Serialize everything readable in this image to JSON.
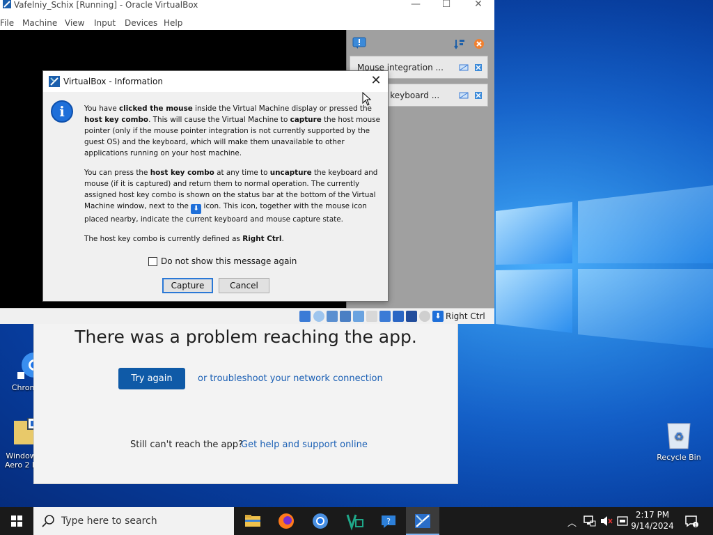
{
  "vbox": {
    "title": "Vafelniy_Schix [Running] - Oracle VirtualBox",
    "menu": [
      "File",
      "Machine",
      "View",
      "Input",
      "Devices",
      "Help"
    ],
    "notifications": [
      "Mouse integration ...",
      "...pture keyboard ..."
    ],
    "host_key_label": "Right Ctrl"
  },
  "dialog": {
    "title": "VirtualBox - Information",
    "p1": {
      "t1": "You have ",
      "b1": "clicked the mouse",
      "t2": " inside the Virtual Machine display or pressed the ",
      "b2": "host key combo",
      "t3": ". This will cause the Virtual Machine to ",
      "b3": "capture",
      "t4": " the host mouse pointer (only if the mouse pointer integration is not currently supported by the guest OS) and the keyboard, which will make them unavailable to other applications running on your host machine."
    },
    "p2": {
      "t1": "You can press the ",
      "b1": "host key combo",
      "t2": " at any time to ",
      "b2": "uncapture",
      "t3": " the keyboard and mouse (if it is captured) and return them to normal operation. The currently assigned host key combo is shown on the status bar at the bottom of the Virtual Machine window, next to the ",
      "t4": " icon. This icon, together with the mouse icon placed nearby, indicate the current keyboard and mouse capture state."
    },
    "p3": {
      "t1": "The host key combo is currently defined as ",
      "b1": "Right Ctrl",
      "t2": "."
    },
    "checkbox_label": "Do not show this message again",
    "capture_label": "Capture",
    "cancel_label": "Cancel"
  },
  "store": {
    "title": "There was a problem reaching the app.",
    "try_again": "Try again",
    "troubleshoot": "or troubleshoot your network connection",
    "still": "Still can't reach the app?",
    "help_link": "Get help and support online"
  },
  "desktop": {
    "icons": [
      "Chrom",
      "Window\nAero 2 b",
      "Recycle Bin"
    ]
  },
  "taskbar": {
    "search_placeholder": "Type here to search",
    "time": "2:17 PM",
    "date": "9/14/2024"
  },
  "colors": {
    "accent": "#0f5aa7",
    "link": "#1a5fb4",
    "taskbar": "#1a1a1a"
  }
}
